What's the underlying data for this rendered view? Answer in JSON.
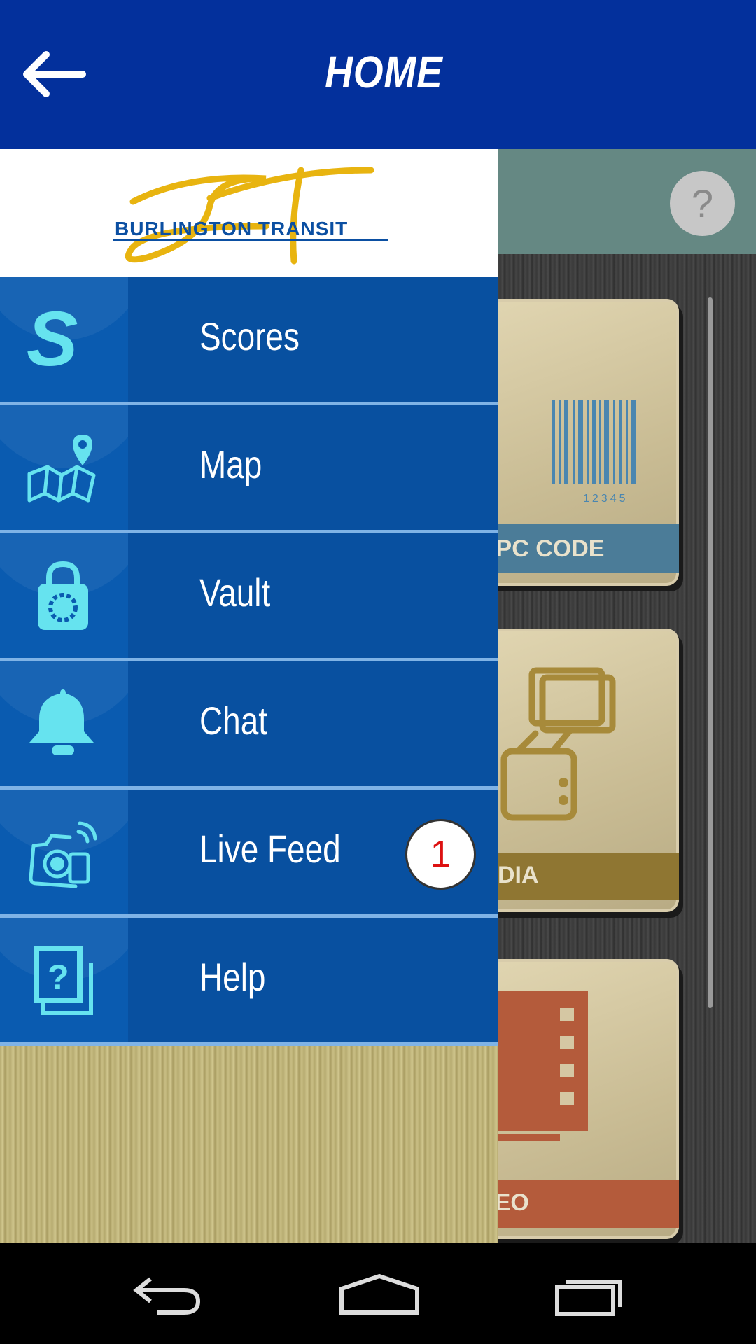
{
  "appbar": {
    "title": "HOME",
    "back_icon": "arrow-left-icon"
  },
  "colors": {
    "appbar": "#03309c",
    "menu_item": "#0850a0",
    "icon_accent": "#66e3ef",
    "badge_text": "#dd1111"
  },
  "logo": {
    "text": "BURLINGTON TRANSIT"
  },
  "menu": {
    "items": [
      {
        "label": "Scores",
        "icon": "scores-s-icon"
      },
      {
        "label": "Map",
        "icon": "map-pin-icon"
      },
      {
        "label": "Vault",
        "icon": "lock-icon"
      },
      {
        "label": "Chat",
        "icon": "bell-icon"
      },
      {
        "label": "Live Feed",
        "icon": "camera-wifi-icon",
        "badge": "1"
      },
      {
        "label": "Help",
        "icon": "help-pages-icon"
      }
    ]
  },
  "background": {
    "help_button": "?",
    "tiles": [
      {
        "caption": "& UPC CODE",
        "barcode_digits": "12345"
      },
      {
        "caption": "MEDIA"
      },
      {
        "caption": "VIDEO"
      }
    ]
  },
  "navbar": {
    "back": "nav-back-icon",
    "home": "nav-home-icon",
    "recents": "nav-recents-icon"
  }
}
